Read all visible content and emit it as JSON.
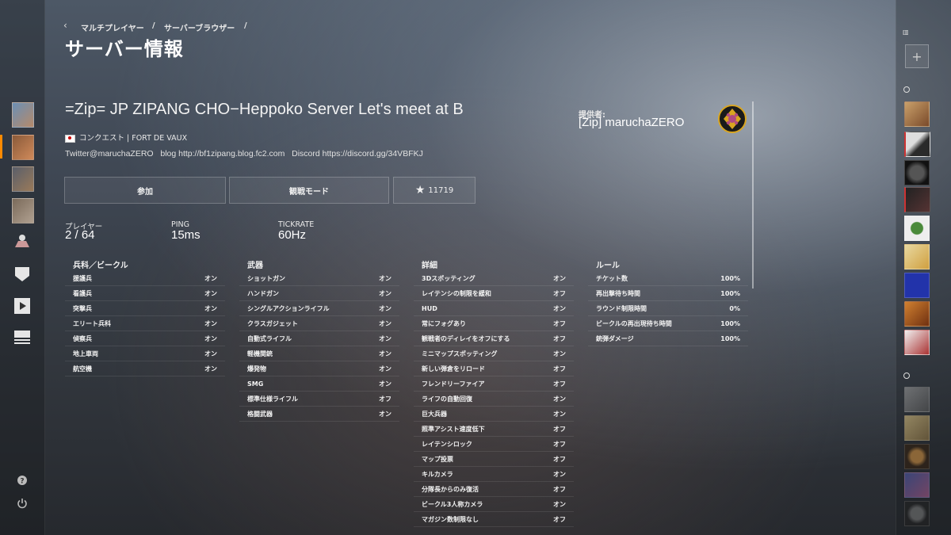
{
  "breadcrumb": {
    "items": [
      "マルチプレイヤー",
      "サーバーブラウザー"
    ],
    "sep": "/"
  },
  "page_title": "サーバー情報",
  "server": {
    "name": "=Zip= JP ZIPANG CHO−Heppoko Server Let's meet at B",
    "mode_map": "コンクエスト | FORT DE VAUX",
    "description": "Twitter@maruchaZERO   blog http://bf1zipang.blog.fc2.com   Discord https://discord.gg/34VBFKJ"
  },
  "provider": {
    "label": "提供者:",
    "name": "[Zip] maruchaZERO"
  },
  "buttons": {
    "join": "参加",
    "spectate": "観戦モード",
    "favorites": "11719"
  },
  "stats": {
    "players_label": "プレイヤー",
    "players_value": "2 / 64",
    "ping_label": "PING",
    "ping_value": "15ms",
    "tickrate_label": "TICKRATE",
    "tickrate_value": "60Hz"
  },
  "kits": {
    "title": "兵科／ビークル",
    "rows": [
      {
        "name": "援護兵",
        "value": "オン"
      },
      {
        "name": "看護兵",
        "value": "オン"
      },
      {
        "name": "突撃兵",
        "value": "オン"
      },
      {
        "name": "エリート兵科",
        "value": "オン"
      },
      {
        "name": "偵察兵",
        "value": "オン"
      },
      {
        "name": "地上車両",
        "value": "オン"
      },
      {
        "name": "航空機",
        "value": "オン"
      }
    ]
  },
  "weapons": {
    "title": "武器",
    "rows": [
      {
        "name": "ショットガン",
        "value": "オン"
      },
      {
        "name": "ハンドガン",
        "value": "オン"
      },
      {
        "name": "シングルアクションライフル",
        "value": "オン"
      },
      {
        "name": "クラスガジェット",
        "value": "オン"
      },
      {
        "name": "自動式ライフル",
        "value": "オン"
      },
      {
        "name": "軽機関銃",
        "value": "オン"
      },
      {
        "name": "爆発物",
        "value": "オン"
      },
      {
        "name": "SMG",
        "value": "オン"
      },
      {
        "name": "標準仕様ライフル",
        "value": "オフ"
      },
      {
        "name": "格闘武器",
        "value": "オン"
      }
    ]
  },
  "details": {
    "title": "詳細",
    "rows": [
      {
        "name": "3Dスポッティング",
        "value": "オン"
      },
      {
        "name": "レイテンシの制限を緩和",
        "value": "オフ"
      },
      {
        "name": "HUD",
        "value": "オン"
      },
      {
        "name": "常にフォグあり",
        "value": "オフ"
      },
      {
        "name": "観戦者のディレイをオフにする",
        "value": "オフ"
      },
      {
        "name": "ミニマップスポッティング",
        "value": "オン"
      },
      {
        "name": "新しい弾倉をリロード",
        "value": "オフ"
      },
      {
        "name": "フレンドリーファイア",
        "value": "オフ"
      },
      {
        "name": "ライフの自動回復",
        "value": "オン"
      },
      {
        "name": "巨大兵器",
        "value": "オン"
      },
      {
        "name": "照準アシスト速度低下",
        "value": "オフ"
      },
      {
        "name": "レイテンシロック",
        "value": "オフ"
      },
      {
        "name": "マップ投票",
        "value": "オフ"
      },
      {
        "name": "キルカメラ",
        "value": "オン"
      },
      {
        "name": "分隊長からのみ復活",
        "value": "オフ"
      },
      {
        "name": "ビークル3人称カメラ",
        "value": "オン"
      },
      {
        "name": "マガジン数制限なし",
        "value": "オフ"
      }
    ]
  },
  "rules": {
    "title": "ルール",
    "rows": [
      {
        "name": "チケット数",
        "value": "100%"
      },
      {
        "name": "再出撃待ち時間",
        "value": "100%"
      },
      {
        "name": "ラウンド制限時間",
        "value": "0%"
      },
      {
        "name": "ビークルの再出現待ち時間",
        "value": "100%"
      },
      {
        "name": "銃弾ダメージ",
        "value": "100%"
      }
    ]
  },
  "colors": {
    "accent": "#ff8a00",
    "emblem_gold": "#d9a520"
  },
  "icons": {
    "star": "★",
    "back": "chevron-left-icon",
    "help": "help-icon",
    "power": "power-icon"
  }
}
